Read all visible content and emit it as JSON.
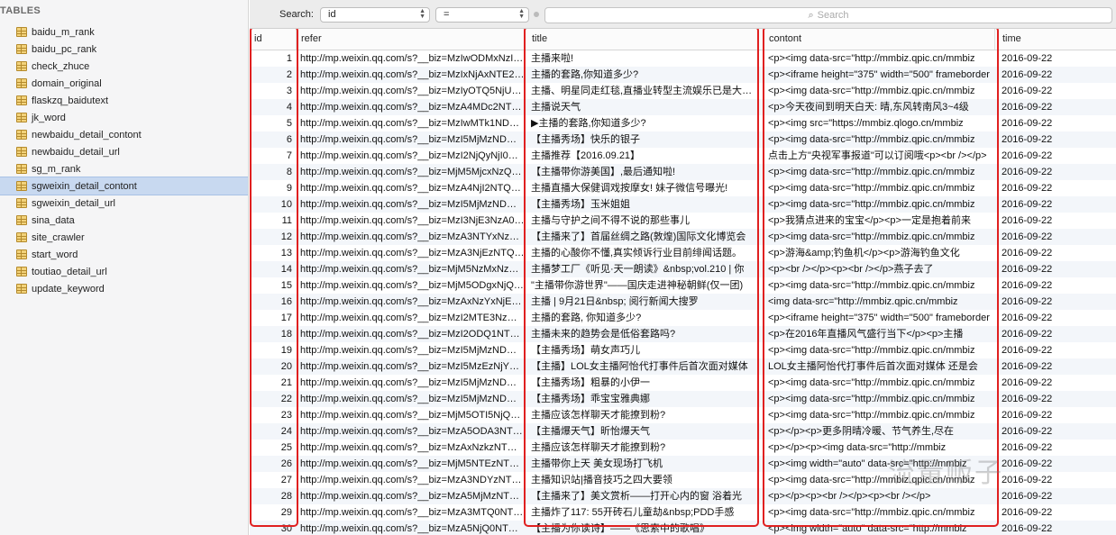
{
  "sidebar": {
    "header": "TABLES",
    "items": [
      {
        "label": "baidu_m_rank",
        "selected": false
      },
      {
        "label": "baidu_pc_rank",
        "selected": false
      },
      {
        "label": "check_zhuce",
        "selected": false
      },
      {
        "label": "domain_original",
        "selected": false
      },
      {
        "label": "flaskzq_baidutext",
        "selected": false
      },
      {
        "label": "jk_word",
        "selected": false
      },
      {
        "label": "newbaidu_detail_contont",
        "selected": false
      },
      {
        "label": "newbaidu_detail_url",
        "selected": false
      },
      {
        "label": "sg_m_rank",
        "selected": false
      },
      {
        "label": "sgweixin_detail_contont",
        "selected": true
      },
      {
        "label": "sgweixin_detail_url",
        "selected": false
      },
      {
        "label": "sina_data",
        "selected": false
      },
      {
        "label": "site_crawler",
        "selected": false
      },
      {
        "label": "start_word",
        "selected": false
      },
      {
        "label": "toutiao_detail_url",
        "selected": false
      },
      {
        "label": "update_keyword",
        "selected": false
      }
    ]
  },
  "search": {
    "label": "Search:",
    "field_value": "id",
    "operator_value": "=",
    "placeholder": "Search"
  },
  "table": {
    "columns": [
      "id",
      "refer",
      "title",
      "contont",
      "time"
    ],
    "rows": [
      [
        "1",
        "http://mp.weixin.qq.com/s?__biz=MzIwODMxNzI1Mg==&mid",
        "主播来啦!",
        "<p><img  data-src=\"http://mmbiz.qpic.cn/mmbiz",
        "2016-09-22"
      ],
      [
        "2",
        "http://mp.weixin.qq.com/s?__biz=MzIxNjAxNTE2Mw==&mid",
        "主播的套路,你知道多少?",
        "<p><iframe  height=\"375\" width=\"500\" frameborder",
        "2016-09-22"
      ],
      [
        "3",
        "http://mp.weixin.qq.com/s?__biz=MzIyOTQ5NjU2Mw==&mid",
        "主播、明星同走红毯,直播业转型主流娱乐已是大势所趋",
        "<p><img  data-src=\"http://mmbiz.qpic.cn/mmbiz",
        "2016-09-22"
      ],
      [
        "4",
        "http://mp.weixin.qq.com/s?__biz=MzA4MDc2NTQ0MA==&mid",
        "主播说天气",
        "<p>今天夜间到明天白天: 晴,东风转南风3~4级",
        "2016-09-22"
      ],
      [
        "5",
        "http://mp.weixin.qq.com/s?__biz=MzIwMTk1NDYzNQ==&mid",
        "▶主播的套路,你知道多少?",
        "<p><img src=\"https://mmbiz.qlogo.cn/mmbiz",
        "2016-09-22"
      ],
      [
        "6",
        "http://mp.weixin.qq.com/s?__biz=MzI5MjMzNDM2NQ==&mid",
        "【主播秀场】快乐的银子",
        "<p><img  data-src=\"http://mmbiz.qpic.cn/mmbiz",
        "2016-09-22"
      ],
      [
        "7",
        "http://mp.weixin.qq.com/s?__biz=MzI2NjQyNjI0Mw==&mid",
        "主播推荐【2016.09.21】",
        "点击上方\"央视军事报道\"可以订阅哦<p><br  /></p>",
        "2016-09-22"
      ],
      [
        "8",
        "http://mp.weixin.qq.com/s?__biz=MjM5MjcxNzQyMA==&mid",
        "【主播带你游美国】,最后通知啦!",
        "<p><img  data-src=\"http://mmbiz.qpic.cn/mmbiz",
        "2016-09-22"
      ],
      [
        "9",
        "http://mp.weixin.qq.com/s?__biz=MzA4NjI2NTQ4Mw==&mid",
        "主播直播大保健调戏按摩女! 妹子微信号曝光!",
        "<p><img  data-src=\"http://mmbiz.qpic.cn/mmbiz",
        "2016-09-22"
      ],
      [
        "10",
        "http://mp.weixin.qq.com/s?__biz=MzI5MjMzNDM2NQ==&mid",
        "【主播秀场】玉米姐姐",
        "<p><img  data-src=\"http://mmbiz.qpic.cn/mmbiz",
        "2016-09-22"
      ],
      [
        "11",
        "http://mp.weixin.qq.com/s?__biz=MzI3NjE3NzA0Ng==&mid",
        "主播与守护之间不得不说的那些事儿",
        "<p>我猜点进来的宝宝</p><p>一定是抱着前来",
        "2016-09-22"
      ],
      [
        "12",
        "http://mp.weixin.qq.com/s?__biz=MzA3NTYxNzE3Ng==&mid",
        "【主播来了】首届丝绸之路(敦煌)国际文化博览会",
        "<p><img  data-src=\"http://mmbiz.qpic.cn/mmbiz",
        "2016-09-22"
      ],
      [
        "13",
        "http://mp.weixin.qq.com/s?__biz=MzA3NjEzNTQ2MA==&mid",
        "主播的心酸你不懂,真实倾诉行业目前绯闻话题。",
        "<p>游海&amp;钓鱼机</p><p>游海钓鱼文化",
        "2016-09-22"
      ],
      [
        "14",
        "http://mp.weixin.qq.com/s?__biz=MjM5NzMxNzQ0MA==&mid",
        "主播梦工厂《听见·天一朗读》&nbsp;vol.210 | 你",
        "<p><br  /></p><p><br  /></p>燕子去了",
        "2016-09-22"
      ],
      [
        "15",
        "http://mp.weixin.qq.com/s?__biz=MjM5ODgxNjQ2MA==&mid",
        "\"主播带你游世界\"——国庆走进神秘朝鲜(仅一团)",
        "<p><img  data-src=\"http://mmbiz.qpic.cn/mmbiz",
        "2016-09-22"
      ],
      [
        "16",
        "http://mp.weixin.qq.com/s?__biz=MzAxNzYxNjE4Mg==&mid",
        "主播 | 9月21日&nbsp; 阅行新闻大搜罗",
        "<img  data-src=\"http://mmbiz.qpic.cn/mmbiz",
        "2016-09-22"
      ],
      [
        "17",
        "http://mp.weixin.qq.com/s?__biz=MzI2MTE3NzQwMA==&mid",
        "主播的套路, 你知道多少?",
        "<p><iframe  height=\"375\" width=\"500\" frameborder",
        "2016-09-22"
      ],
      [
        "18",
        "http://mp.weixin.qq.com/s?__biz=MzI2ODQ1NTQ0Mw==&mid",
        "主播未来的趋势会是低俗套路吗?",
        "<p>在2016年直播风气盛行当下</p><p>主播",
        "2016-09-22"
      ],
      [
        "19",
        "http://mp.weixin.qq.com/s?__biz=MzI5MjMzNDM2NQ==&mid",
        "【主播秀场】萌女声巧儿",
        "<p><img  data-src=\"http://mmbiz.qpic.cn/mmbiz",
        "2016-09-22"
      ],
      [
        "20",
        "http://mp.weixin.qq.com/s?__biz=MzI5MzEzNjY0MA==&mid",
        "【主播】LOL女主播阿怡代打事件后首次面对媒体",
        "LOL女主播阿怡代打事件后首次面对媒体 还是会",
        "2016-09-22"
      ],
      [
        "21",
        "http://mp.weixin.qq.com/s?__biz=MzI5MjMzNDM2NQ==&mid",
        "【主播秀场】粗暴的小伊一",
        "<p><img  data-src=\"http://mmbiz.qpic.cn/mmbiz",
        "2016-09-22"
      ],
      [
        "22",
        "http://mp.weixin.qq.com/s?__biz=MzI5MjMzNDM2NQ==&mid",
        "【主播秀场】乖宝宝雅典娜",
        "<p><img  data-src=\"http://mmbiz.qpic.cn/mmbiz",
        "2016-09-22"
      ],
      [
        "23",
        "http://mp.weixin.qq.com/s?__biz=MjM5OTI5NjQ0MA==&mid",
        "主播应该怎样聊天才能撩到粉?",
        "<p><img  data-src=\"http://mmbiz.qpic.cn/mmbiz",
        "2016-09-22"
      ],
      [
        "24",
        "http://mp.weixin.qq.com/s?__biz=MzA5ODA3NTQ0MA==&mid",
        "【主播爆天气】昕怡爆天气",
        "<p></p><p>更多阴晴冷暖、节气养生,尽在",
        "2016-09-22"
      ],
      [
        "25",
        "http://mp.weixin.qq.com/s?__biz=MzAxNzkzNTQ0MA==&mid",
        "主播应该怎样聊天才能撩到粉?",
        "<p></p><p><img  data-src=\"http://mmbiz",
        "2016-09-22"
      ],
      [
        "26",
        "http://mp.weixin.qq.com/s?__biz=MjM5NTEzNTQ0MA==&mid",
        "主播带你上天 美女现场打飞机",
        "<p><img  width=\"auto\" data-src=\"http://mmbiz",
        "2016-09-22"
      ],
      [
        "27",
        "http://mp.weixin.qq.com/s?__biz=MzA3NDYzNTQ0MA==&mid",
        "主播知识站|播音技巧之四大要领",
        "<p><img  data-src=\"http://mmbiz.qpic.cn/mmbiz",
        "2016-09-22"
      ],
      [
        "28",
        "http://mp.weixin.qq.com/s?__biz=MzA5MjMzNTQ0MA==&mid",
        "【主播来了】美文赏析——打开心内的窗 浴着光",
        "<p></p><p><br  /></p><p><br  /></p>",
        "2016-09-22"
      ],
      [
        "29",
        "http://mp.weixin.qq.com/s?__biz=MzA3MTQ0NTQ0MA==&mid",
        "主播炸了117: 55开砖石儿童劫&nbsp;PDD手感",
        "<p><img  data-src=\"http://mmbiz.qpic.cn/mmbiz",
        "2016-09-22"
      ],
      [
        "30",
        "http://mp.weixin.qq.com/s?__biz=MzA5NjQ0NTQ0MA==&mid",
        "【主播为你读诗】——《思索中的歌唱》",
        "<p><img  width=\"auto\" data-src=\"http://mmbiz",
        "2016-09-22"
      ]
    ]
  },
  "colors": {
    "highlight": "#e02020",
    "selected_row": "#c8d9f0",
    "table_icon": "#f2d27a"
  },
  "watermark": "流量贩子"
}
